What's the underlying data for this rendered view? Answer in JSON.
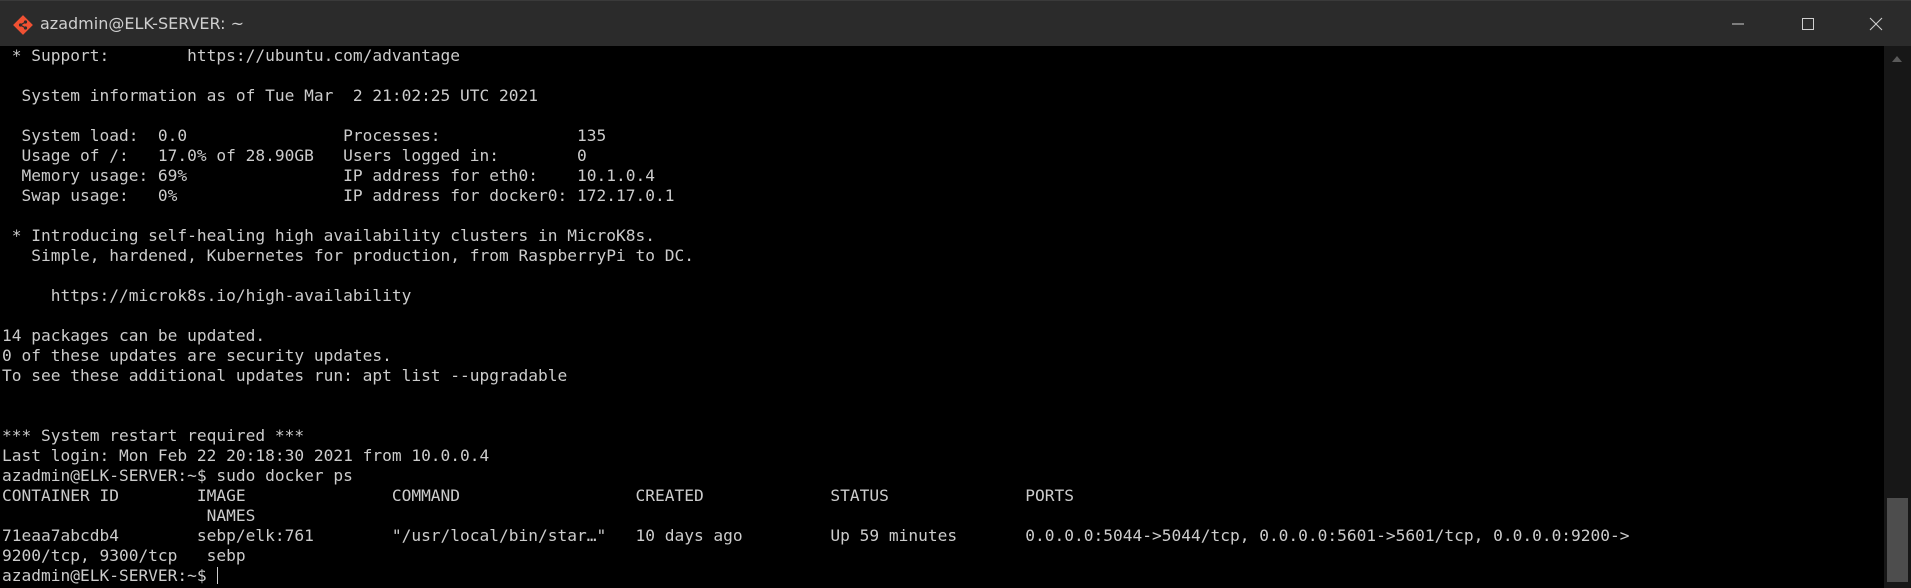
{
  "window": {
    "title": "azadmin@ELK-SERVER: ~",
    "icons": {
      "app": "git-bash-diamond-icon",
      "minimize": "minimize-icon",
      "maximize": "maximize-icon",
      "close": "close-icon"
    },
    "colors": {
      "titlebar": "#2b2b2b",
      "terminal_bg": "#000000",
      "terminal_fg": "#cccccc",
      "icon_orange": "#f05133"
    }
  },
  "terminal": {
    "lines": [
      " * Support:        https://ubuntu.com/advantage",
      "",
      "  System information as of Tue Mar  2 21:02:25 UTC 2021",
      "",
      "  System load:  0.0                Processes:              135",
      "  Usage of /:   17.0% of 28.90GB   Users logged in:        0",
      "  Memory usage: 69%                IP address for eth0:    10.1.0.4",
      "  Swap usage:   0%                 IP address for docker0: 172.17.0.1",
      "",
      " * Introducing self-healing high availability clusters in MicroK8s.",
      "   Simple, hardened, Kubernetes for production, from RaspberryPi to DC.",
      "",
      "     https://microk8s.io/high-availability",
      "",
      "14 packages can be updated.",
      "0 of these updates are security updates.",
      "To see these additional updates run: apt list --upgradable",
      "",
      "",
      "*** System restart required ***",
      "Last login: Mon Feb 22 20:18:30 2021 from 10.0.0.4",
      "azadmin@ELK-SERVER:~$ sudo docker ps",
      "CONTAINER ID        IMAGE               COMMAND                  CREATED             STATUS              PORTS",
      "                     NAMES",
      "71eaa7abcdb4        sebp/elk:761        \"/usr/local/bin/star…\"   10 days ago         Up 59 minutes       0.0.0.0:5044->5044/tcp, 0.0.0.0:5601->5601/tcp, 0.0.0.0:9200->",
      "9200/tcp, 9300/tcp   sebp"
    ],
    "prompt": "azadmin@ELK-SERVER:~$ "
  }
}
